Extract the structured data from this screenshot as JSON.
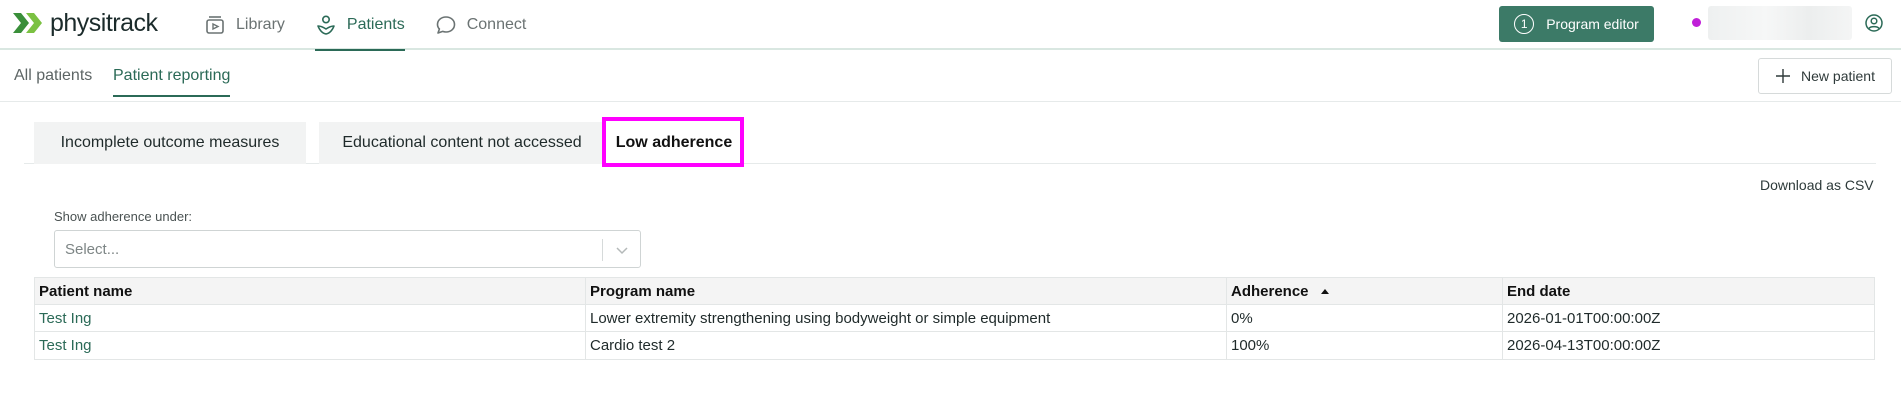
{
  "brand": {
    "name": "physitrack",
    "accent": "#2b6a57",
    "chevron_colors": [
      "#3a8f3a",
      "#7bc142"
    ]
  },
  "nav": {
    "items": [
      {
        "label": "Library",
        "icon": "library-icon"
      },
      {
        "label": "Patients",
        "icon": "patients-icon",
        "active": true
      },
      {
        "label": "Connect",
        "icon": "chat-bubble-icon"
      }
    ]
  },
  "program_editor": {
    "count": "1",
    "label": "Program editor"
  },
  "subnav": {
    "tabs": [
      {
        "label": "All patients"
      },
      {
        "label": "Patient reporting",
        "active": true
      }
    ],
    "new_patient_label": "New patient"
  },
  "report_tabs": [
    {
      "label": "Incomplete outcome measures"
    },
    {
      "label": "Educational content not accessed"
    },
    {
      "label": "Low adherence",
      "active": true
    }
  ],
  "download_csv_label": "Download as CSV",
  "filter": {
    "label": "Show adherence under:",
    "placeholder": "Select..."
  },
  "table": {
    "columns": [
      "Patient name",
      "Program name",
      "Adherence",
      "End date"
    ],
    "sort_column": "Adherence",
    "sort_direction": "ascending",
    "rows": [
      {
        "patient": "Test Ing",
        "program": "Lower extremity strengthening using bodyweight or simple equipment",
        "adherence": "0%",
        "end_date": "2026-01-01T00:00:00Z"
      },
      {
        "patient": "Test Ing",
        "program": "Cardio test 2",
        "adherence": "100%",
        "end_date": "2026-04-13T00:00:00Z"
      }
    ]
  }
}
